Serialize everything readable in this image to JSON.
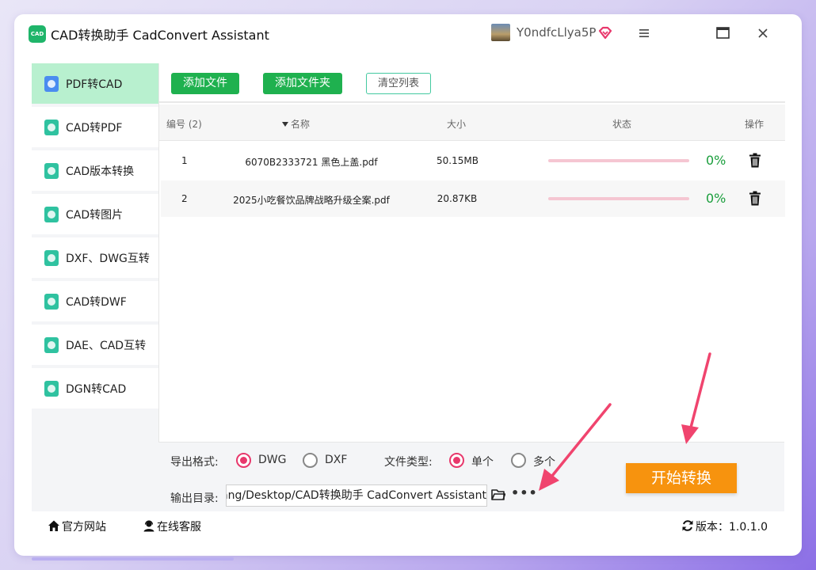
{
  "app": {
    "logo_text": "CAD",
    "title": "CAD转换助手 CadConvert Assistant",
    "username": "Y0ndfcLlya5P"
  },
  "sidebar": {
    "items": [
      {
        "label": "PDF转CAD",
        "active": true
      },
      {
        "label": "CAD转PDF"
      },
      {
        "label": "CAD版本转换"
      },
      {
        "label": "CAD转图片"
      },
      {
        "label": "DXF、DWG互转"
      },
      {
        "label": "CAD转DWF"
      },
      {
        "label": "DAE、CAD互转"
      },
      {
        "label": "DGN转CAD"
      }
    ]
  },
  "toolbar": {
    "add_file": "添加文件",
    "add_folder": "添加文件夹",
    "clear_list": "清空列表"
  },
  "table": {
    "headers": {
      "index": "编号 (2)",
      "name": "名称",
      "size": "大小",
      "status": "状态",
      "action": "操作"
    },
    "rows": [
      {
        "index": "1",
        "name": "6070B2333721 黑色上盖.pdf",
        "size": "50.15MB",
        "progress": "0%"
      },
      {
        "index": "2",
        "name": "2025小吃餐饮品牌战略升级全案.pdf",
        "size": "20.87KB",
        "progress": "0%"
      }
    ]
  },
  "options": {
    "format_label": "导出格式:",
    "format_options": [
      "DWG",
      "DXF"
    ],
    "format_selected": "DWG",
    "filetype_label": "文件类型:",
    "filetype_options": [
      "单个",
      "多个"
    ],
    "filetype_selected": "单个",
    "outdir_label": "输出目录:",
    "outdir_value": "oang/Desktop/CAD转换助手 CadConvert Assistant",
    "start_button": "开始转换"
  },
  "footer": {
    "website": "官方网站",
    "service": "在线客服",
    "version": "版本：1.0.1.0"
  },
  "colors": {
    "accent_green": "#1fb14f",
    "start_orange": "#f7930e",
    "radio_pink": "#e8386c",
    "arrow_pink": "#f0446e"
  }
}
